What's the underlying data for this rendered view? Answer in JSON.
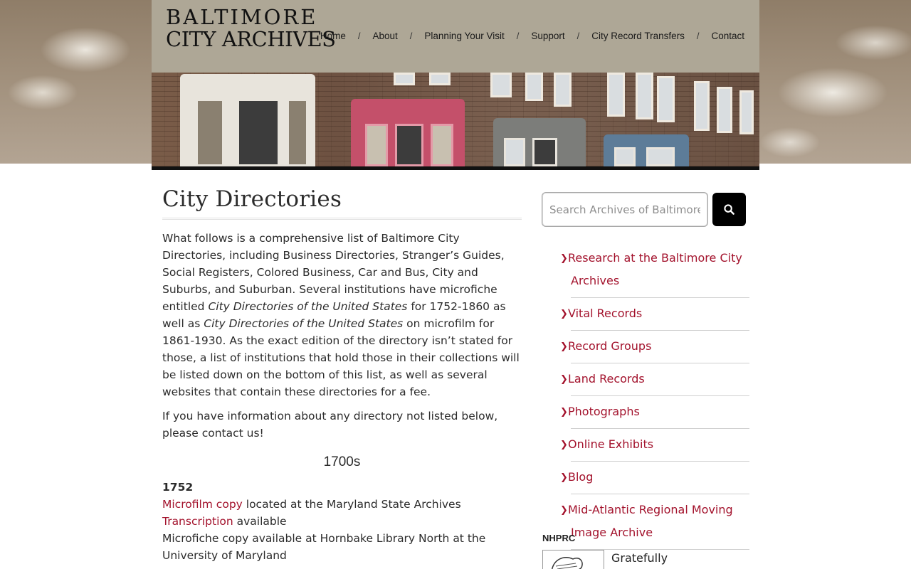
{
  "site": {
    "logo_line1": "BALTIMORE",
    "logo_line2": "CITY ARCHIVES"
  },
  "nav": {
    "items": [
      "Home",
      "About",
      "Planning Your Visit",
      "Support",
      "City Record Transfers",
      "Contact"
    ],
    "separator": "/"
  },
  "main": {
    "title": "City Directories",
    "intro_a": "What follows is a comprehensive list of Baltimore City Directories, including Business Directories, Stranger’s Guides, Social Registers, Colored Business, Car and Bus, City and Suburbs, and Suburban.  Several institutions have microfiche entitled ",
    "intro_em1": "City Directories of the United States",
    "intro_b": " for 1752-1860 as well as ",
    "intro_em2": "City Directories of the United States",
    "intro_c": " on microfilm for 1861-1930.  As the exact edition of the directory isn’t stated for those, a list of institutions that hold those in their collections will be listed down on the bottom of this list, as well as several websites that contain these directories for a fee.",
    "contact_note": "If you have information about any directory not listed below, please contact us!",
    "century": "1700s",
    "entry": {
      "year": "1752",
      "link1": "Microfilm copy",
      "text1": " located at the Maryland State Archives",
      "link2": "Transcription",
      "text2": " available",
      "text3": "Microfiche copy available at Hornbake Library North at the University of Maryland"
    }
  },
  "sidebar": {
    "search_placeholder": "Search Archives of Baltimore",
    "search_icon": "search-icon",
    "links": [
      "Research at the Baltimore City Archives",
      "Vital Records",
      "Record Groups",
      "Land Records",
      "Photographs",
      "Online Exhibits",
      "Blog",
      "Mid-Atlantic Regional Moving Image Archive"
    ],
    "nhprc_heading": "NHPRC",
    "gratefully": "Gratefully"
  },
  "colors": {
    "link": "#a3122c",
    "header_bg": "#aea796",
    "button_bg": "#000000"
  }
}
